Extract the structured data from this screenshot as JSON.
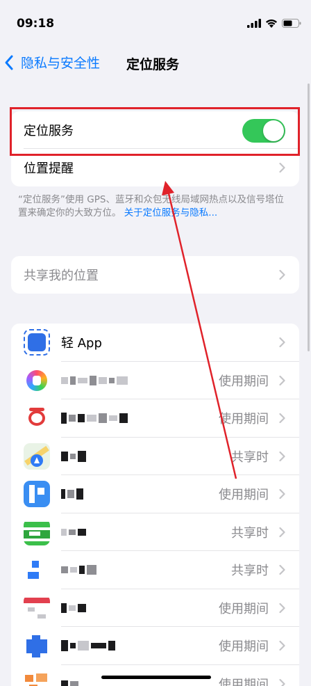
{
  "status": {
    "time": "09:18"
  },
  "nav": {
    "back_label": "隐私与安全性",
    "title": "定位服务"
  },
  "location_group": {
    "toggle_label": "定位服务",
    "toggle_on": true,
    "alerts_label": "位置提醒"
  },
  "footnote": {
    "text": "“定位服务”使用 GPS、蓝牙和众包无线局域网热点以及信号塔位置来确定你的大致方位。",
    "link": "关于定位服务与隐私..."
  },
  "share_group": {
    "label": "共享我的位置"
  },
  "apps": [
    {
      "name": "轻 App",
      "permission": ""
    },
    {
      "name": "",
      "permission": "使用期间"
    },
    {
      "name": "",
      "permission": "使用期间"
    },
    {
      "name": "",
      "permission": "共享时"
    },
    {
      "name": "",
      "permission": "使用期间"
    },
    {
      "name": "",
      "permission": "共享时"
    },
    {
      "name": "",
      "permission": "共享时"
    },
    {
      "name": "",
      "permission": "使用期间"
    },
    {
      "name": "",
      "permission": "使用期间"
    },
    {
      "name": "",
      "permission": "使用期间"
    }
  ],
  "colors": {
    "accent": "#0a7aff",
    "toggle_on": "#34c759",
    "highlight": "#e0222a"
  }
}
